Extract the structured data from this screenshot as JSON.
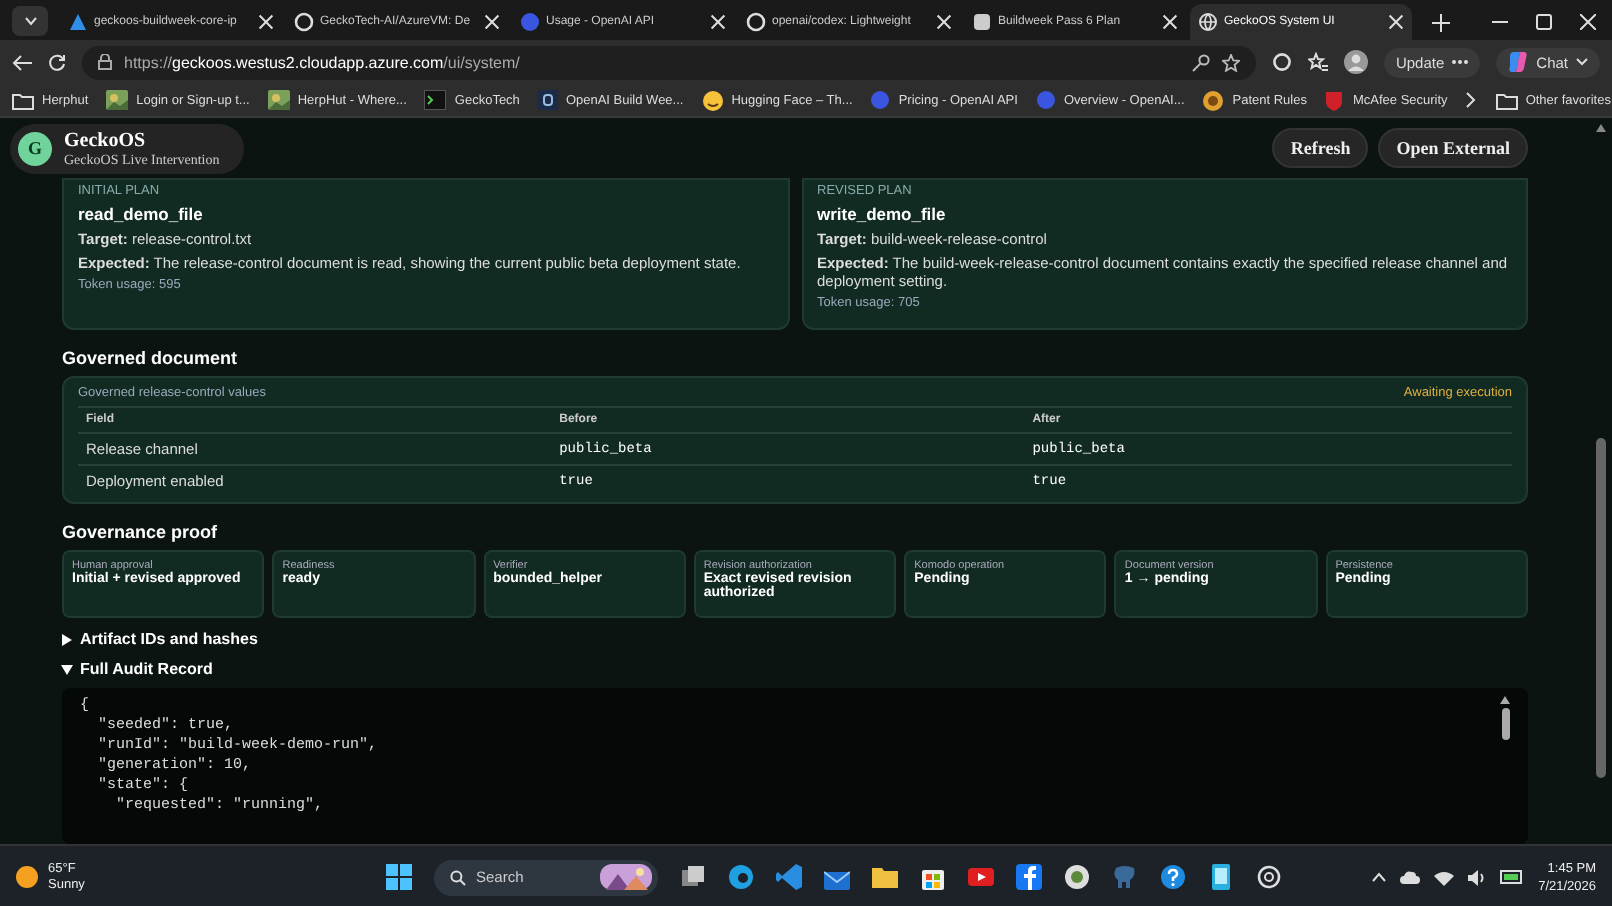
{
  "browser": {
    "tabs": [
      {
        "title": "geckoos-buildweek-core-ip",
        "selected": false
      },
      {
        "title": "GeckoTech-AI/AzureVM: De",
        "selected": false
      },
      {
        "title": "Usage - OpenAI API",
        "selected": false
      },
      {
        "title": "openai/codex: Lightweight",
        "selected": false
      },
      {
        "title": "Buildweek Pass 6 Plan",
        "selected": false
      },
      {
        "title": "GeckoOS System UI",
        "selected": true
      }
    ],
    "url": {
      "scheme": "https://",
      "host": "geckoos.westus2.cloudapp.azure.com",
      "path": "/ui/system/"
    },
    "update_button": "Update",
    "chat_button": "Chat",
    "bookmarks": [
      {
        "label": "Herphut"
      },
      {
        "label": "Login or Sign-up t..."
      },
      {
        "label": "HerpHut - Where..."
      },
      {
        "label": "GeckoTech"
      },
      {
        "label": "OpenAI Build Wee..."
      },
      {
        "label": "Hugging Face – Th..."
      },
      {
        "label": "Pricing - OpenAI API"
      },
      {
        "label": "Overview - OpenAI..."
      },
      {
        "label": "Patent Rules"
      },
      {
        "label": "McAfee Security"
      }
    ],
    "other_favorites": "Other favorites"
  },
  "app": {
    "name": "GeckoOS",
    "subtitle": "GeckoOS Live Intervention",
    "avatar": "G",
    "buttons": [
      "Refresh",
      "Open External"
    ]
  },
  "plans": [
    {
      "label": "INITIAL PLAN",
      "name": "read_demo_file",
      "target": "**Target:** release-control.txt",
      "expected": "**Expected:** The release-control document is read, showing the current public beta deployment state.",
      "tokens": "Token usage: 595"
    },
    {
      "label": "REVISED PLAN",
      "name": "write_demo_file",
      "target": "**Target:** build-week-release-control",
      "expected": "**Expected:** The build-week-release-control document contains exactly the specified release channel and deployment setting.",
      "tokens": "Token usage: 705"
    }
  ],
  "governed_document": {
    "heading": "Governed document",
    "panel_title": "Governed release-control values",
    "status": "Awaiting execution",
    "columns": [
      "Field",
      "Before",
      "After"
    ],
    "rows": [
      [
        "Release channel",
        "public_beta",
        "public_beta"
      ],
      [
        "Deployment enabled",
        "true",
        "true"
      ]
    ]
  },
  "governance_proof": {
    "heading": "Governance proof",
    "items": [
      {
        "label": "Human approval",
        "value": "Initial + revised approved"
      },
      {
        "label": "Readiness",
        "value": "ready"
      },
      {
        "label": "Verifier",
        "value": "bounded_helper"
      },
      {
        "label": "Revision authorization",
        "value": "Exact revised revision authorized"
      },
      {
        "label": "Komodo operation",
        "value": "Pending"
      },
      {
        "label": "Document version",
        "value": "1 → pending"
      },
      {
        "label": "Persistence",
        "value": "Pending"
      }
    ]
  },
  "disclosures": [
    {
      "label": "Artifact IDs and hashes",
      "expanded": false
    },
    {
      "label": "Full Audit Record",
      "expanded": true
    }
  ],
  "audit_record": [
    "{",
    "  \"seeded\": true,",
    "  \"runId\": \"build-week-demo-run\",",
    "  \"generation\": 10,",
    "  \"state\": {",
    "    \"requested\": \"running\","
  ],
  "taskbar": {
    "temperature": "65°F",
    "condition": "Sunny",
    "search_placeholder": "Search",
    "time": "1:45 PM",
    "date": "7/21/2026"
  }
}
